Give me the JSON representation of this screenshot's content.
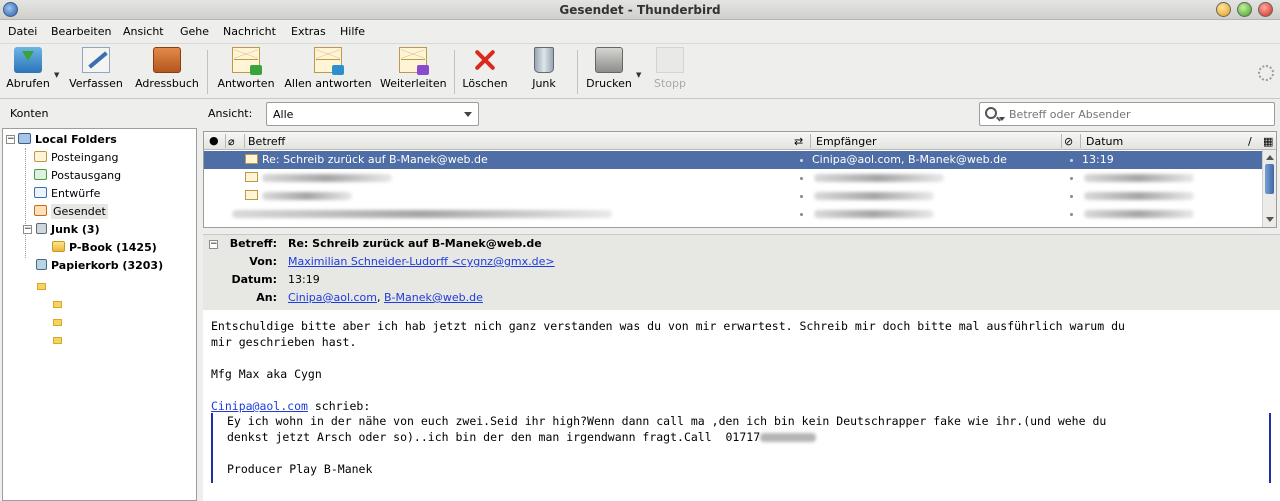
{
  "window": {
    "title": "Gesendet - Thunderbird"
  },
  "menu": [
    "Datei",
    "Bearbeiten",
    "Ansicht",
    "Gehe",
    "Nachricht",
    "Extras",
    "Hilfe"
  ],
  "toolbar": {
    "get": "Abrufen",
    "write": "Verfassen",
    "addressbook": "Adressbuch",
    "reply": "Antworten",
    "reply_all": "Allen antworten",
    "forward": "Weiterleiten",
    "delete": "Löschen",
    "junk": "Junk",
    "print": "Drucken",
    "stop": "Stopp"
  },
  "folders": {
    "header": "Konten",
    "root": "Local Folders",
    "items": [
      "Posteingang",
      "Postausgang",
      "Entwürfe",
      "Gesendet"
    ],
    "junk": "Junk (3)",
    "pbook": "P-Book (1425)",
    "trash": "Papierkorb (3203)",
    "selected": "Gesendet"
  },
  "view": {
    "label": "Ansicht:",
    "value": "Alle"
  },
  "search": {
    "placeholder": "Betreff oder Absender"
  },
  "columns": {
    "subject": "Betreff",
    "recipient": "Empfänger",
    "date": "Datum"
  },
  "messages": [
    {
      "subject": "Re: Schreib zurück auf B-Manek@web.de",
      "recipient": "Cinipa@aol.com, B-Manek@web.de",
      "date": "13:19",
      "selected": true
    }
  ],
  "header": {
    "subject_label": "Betreff:",
    "subject": "Re: Schreib zurück auf B-Manek@web.de",
    "from_label": "Von:",
    "from": "Maximilian Schneider-Ludorff <cygnz@gmx.de>",
    "date_label": "Datum:",
    "date": "13:19",
    "to_label": "An:",
    "to1": "Cinipa@aol.com",
    "to_sep": ",",
    "to2": "B-Manek@web.de"
  },
  "body": {
    "line1": "Entschuldige bitte aber ich hab jetzt nich ganz verstanden was du von mir erwartest. Schreib mir doch bitte mal ausführlich warum du",
    "line2": "mir geschrieben hast.",
    "line3": "Mfg Max aka Cygn",
    "quote_author": "Cinipa@aol.com",
    "quote_intro": " schrieb:",
    "quote1": "Ey ich wohn in der nähe von euch zwei.Seid ihr high?Wenn dann call ma ,den ich bin kein Deutschrapper fake wie ihr.(und wehe du",
    "quote2": "denkst jetzt Arsch oder so)..ich bin der den man irgendwann fragt.Call  01717",
    "quote3": "Producer Play B-Manek"
  },
  "colors": {
    "selection": "#4f6ea6",
    "link": "#1e3cdc",
    "quote_bar": "#1c2fa6"
  }
}
